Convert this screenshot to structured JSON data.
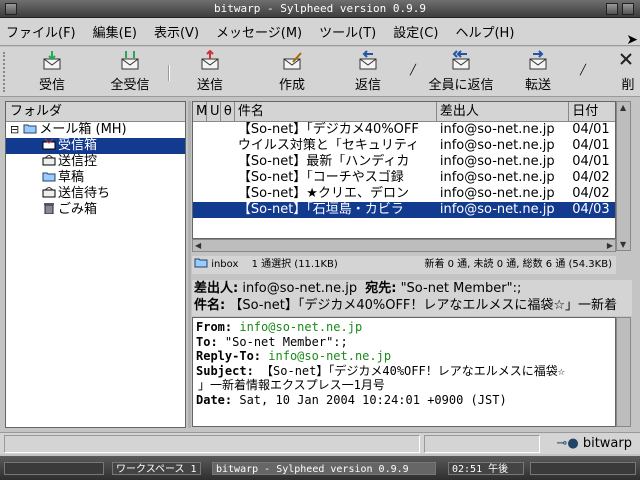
{
  "window": {
    "title": "bitwarp - Sylpheed version 0.9.9"
  },
  "menubar": {
    "items": [
      "ファイル(F)",
      "編集(E)",
      "表示(V)",
      "メッセージ(M)",
      "ツール(T)",
      "設定(C)",
      "ヘルプ(H)"
    ]
  },
  "toolbar": {
    "receive": "受信",
    "receive_all": "全受信",
    "send": "送信",
    "compose": "作成",
    "reply": "返信",
    "reply_all": "全員に返信",
    "forward": "転送",
    "delete": "削"
  },
  "folders": {
    "header": "フォルダ",
    "mailbox": "メール箱 (MH)",
    "items": [
      "受信箱",
      "送信控",
      "草稿",
      "送信待ち",
      "ごみ箱"
    ],
    "selected": "受信箱"
  },
  "messagelist": {
    "columns": {
      "mark": "M",
      "unread": "U",
      "attach": "θ",
      "subject": "件名",
      "from": "差出人",
      "date": "日付"
    },
    "rows": [
      {
        "subject": "【So-net】「デジカメ40%OFF",
        "from": "info@so-net.ne.jp",
        "date": "04/01"
      },
      {
        "subject": "ウイルス対策と「セキュリティ",
        "from": "info@so-net.ne.jp",
        "date": "04/01"
      },
      {
        "subject": "【So-net】最新「ハンディカ",
        "from": "info@so-net.ne.jp",
        "date": "04/01"
      },
      {
        "subject": "【So-net】「コーチやスゴ録",
        "from": "info@so-net.ne.jp",
        "date": "04/02"
      },
      {
        "subject": "【So-net】★クリエ、デロン",
        "from": "info@so-net.ne.jp",
        "date": "04/02"
      },
      {
        "subject": "【So-net】「石垣島・カビラ",
        "from": "info@so-net.ne.jp",
        "date": "04/03"
      }
    ]
  },
  "status": {
    "folder": "inbox",
    "selection": "1 通選択 (11.1KB)",
    "counts": "新着 0 通, 未読 0 通, 総数 6 通 (54.3KB)"
  },
  "header_summary": {
    "from_label": "差出人:",
    "from_value": "info@so-net.ne.jp",
    "to_label": "宛先:",
    "to_value": "\"So-net Member\":;",
    "subject_label": "件名:",
    "subject_value": "【So-net】「デジカメ40%OFF！レアなエルメスに福袋☆」一新着"
  },
  "message": {
    "from_label": "From:",
    "from_value": "info@so-net.ne.jp",
    "to_label": "To:",
    "to_value": "\"So-net Member\":;",
    "replyto_label": "Reply-To:",
    "replyto_value": "info@so-net.ne.jp",
    "subject_label": "Subject:",
    "subject_line1": "【So-net】「デジカメ40%OFF！レアなエルメスに福袋☆",
    "subject_line2": "」一新着情報エクスプレス一1月号",
    "date_label": "Date:",
    "date_value": "Sat, 10 Jan 2004 10:24:01 +0900 (JST)"
  },
  "bottombar": {
    "account": "bitwarp"
  },
  "taskbar": {
    "workspace": "ワークスペース 1",
    "task": "bitwarp - Sylpheed version 0.9.9",
    "clock": "02:51 午後"
  }
}
